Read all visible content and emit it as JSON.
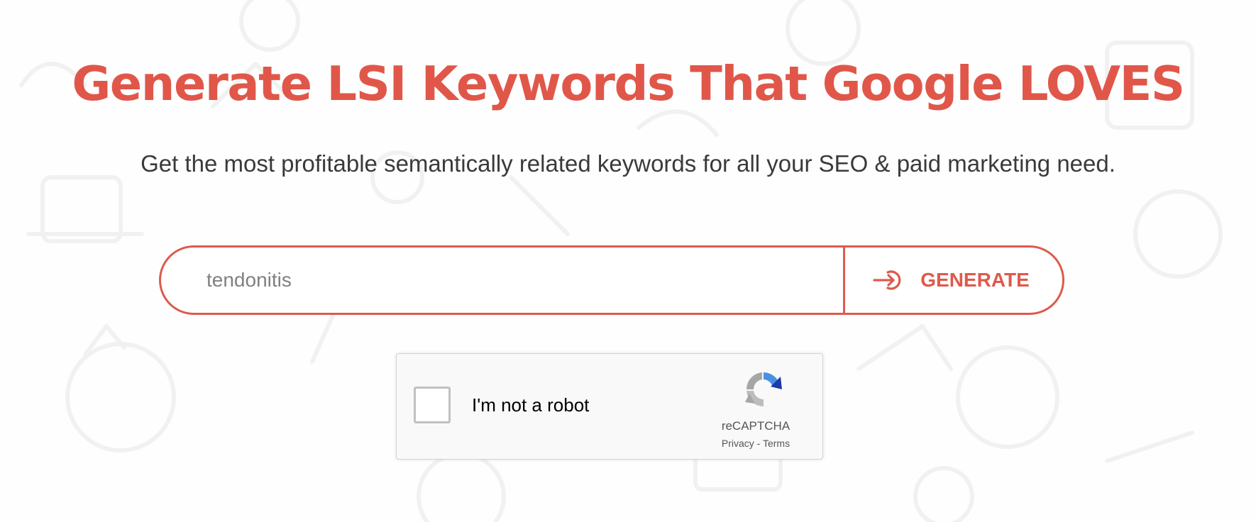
{
  "hero": {
    "title": "Generate LSI Keywords That Google LOVES",
    "subtitle": "Get the most profitable semantically related keywords for all your SEO & paid marketing need."
  },
  "search": {
    "value": "tendonitis",
    "button_label": "GENERATE",
    "button_icon": "sign-in-arrow-icon"
  },
  "recaptcha": {
    "label": "I'm not a robot",
    "brand": "reCAPTCHA",
    "privacy_label": "Privacy",
    "separator": " - ",
    "terms_label": "Terms",
    "checked": false
  },
  "colors": {
    "accent": "#e0574a",
    "subtitle_text": "#3a3a3a",
    "background": "#fefefe",
    "input_text": "#808080",
    "captcha_bg": "#f9f9f9"
  }
}
